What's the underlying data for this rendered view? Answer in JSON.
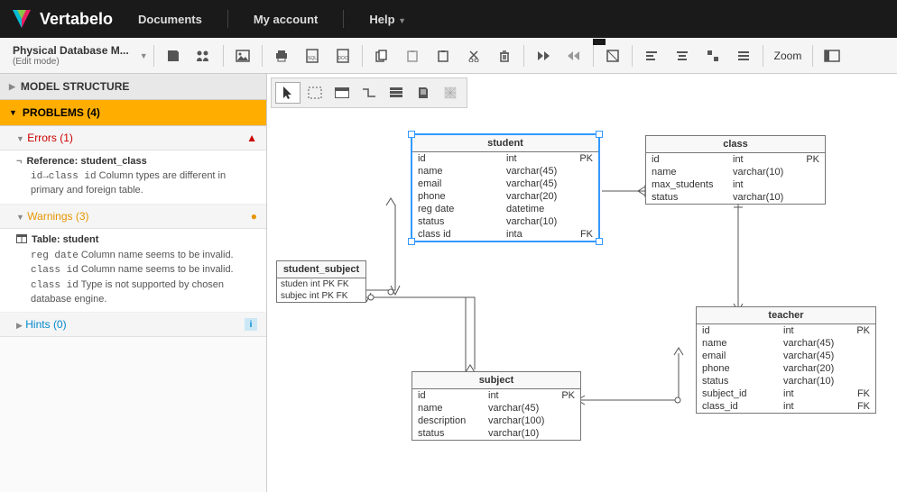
{
  "brand": "Vertabelo",
  "nav": {
    "documents": "Documents",
    "myaccount": "My account",
    "help": "Help"
  },
  "doc": {
    "title": "Physical Database M...",
    "mode": "(Edit mode)"
  },
  "zoom": "Zoom",
  "sidebar": {
    "model_structure": "MODEL STRUCTURE",
    "problems": "PROBLEMS (4)",
    "errors": {
      "label": "Errors (1)"
    },
    "ref_item": {
      "title": "Reference: student_class",
      "desc_mono": "id→class id",
      "desc_text": " Column types are different in primary and foreign table."
    },
    "warnings": {
      "label": "Warnings (3)"
    },
    "table_item": {
      "title": "Table: student",
      "w1_mono": "reg date",
      "w1_text": " Column name seems to be invalid.",
      "w2_mono": "class id",
      "w2_text": " Column name seems to be invalid.",
      "w3_mono": "class id",
      "w3_text": " Type is not supported by chosen database engine."
    },
    "hints": {
      "label": "Hints (0)"
    }
  },
  "entities": {
    "student": {
      "name": "student",
      "cols": [
        {
          "n": "id",
          "t": "int",
          "k": "PK"
        },
        {
          "n": "name",
          "t": "varchar(45)",
          "k": ""
        },
        {
          "n": "email",
          "t": "varchar(45)",
          "k": ""
        },
        {
          "n": "phone",
          "t": "varchar(20)",
          "k": ""
        },
        {
          "n": "reg date",
          "t": "datetime",
          "k": ""
        },
        {
          "n": "status",
          "t": "varchar(10)",
          "k": ""
        },
        {
          "n": "class id",
          "t": "inta",
          "k": "FK"
        }
      ]
    },
    "class": {
      "name": "class",
      "cols": [
        {
          "n": "id",
          "t": "int",
          "k": "PK"
        },
        {
          "n": "name",
          "t": "varchar(10)",
          "k": ""
        },
        {
          "n": "max_students",
          "t": "int",
          "k": ""
        },
        {
          "n": "status",
          "t": "varchar(10)",
          "k": ""
        }
      ]
    },
    "student_subject": {
      "name": "student_subject",
      "cols2": [
        {
          "n": "studen",
          "t": "int",
          "k": "PK FK"
        },
        {
          "n": "subjec",
          "t": "int",
          "k": "PK FK"
        }
      ]
    },
    "subject": {
      "name": "subject",
      "cols": [
        {
          "n": "id",
          "t": "int",
          "k": "PK"
        },
        {
          "n": "name",
          "t": "varchar(45)",
          "k": ""
        },
        {
          "n": "description",
          "t": "varchar(100)",
          "k": ""
        },
        {
          "n": "status",
          "t": "varchar(10)",
          "k": ""
        }
      ]
    },
    "teacher": {
      "name": "teacher",
      "cols": [
        {
          "n": "id",
          "t": "int",
          "k": "PK"
        },
        {
          "n": "name",
          "t": "varchar(45)",
          "k": ""
        },
        {
          "n": "email",
          "t": "varchar(45)",
          "k": ""
        },
        {
          "n": "phone",
          "t": "varchar(20)",
          "k": ""
        },
        {
          "n": "status",
          "t": "varchar(10)",
          "k": ""
        },
        {
          "n": "subject_id",
          "t": "int",
          "k": "FK"
        },
        {
          "n": "class_id",
          "t": "int",
          "k": "FK"
        }
      ]
    }
  }
}
